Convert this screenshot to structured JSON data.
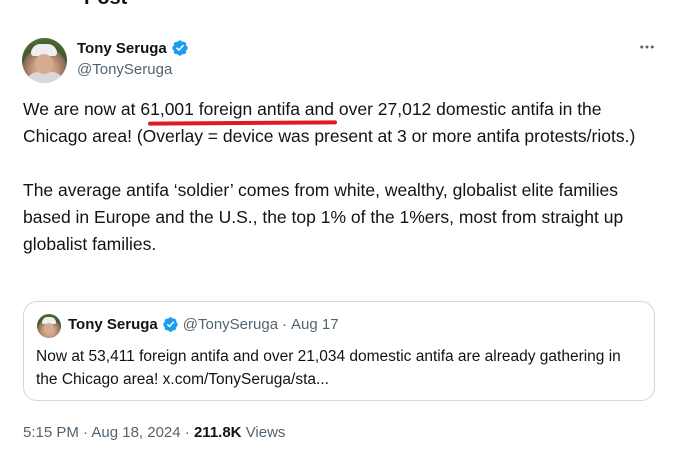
{
  "header": {
    "title_partial": "Post"
  },
  "tweet": {
    "author": {
      "name": "Tony Seruga",
      "handle": "@TonySeruga"
    },
    "paragraphs": [
      "We are now at 61,001 foreign antifa and over 27,012 domestic antifa in the Chicago area! (Overlay = device was present at 3 or more antifa protests/riots.)",
      "The average antifa ‘soldier’ comes from white, wealthy, globalist elite families based in Europe and the U.S., the top 1% of the 1%ers, most from straight up globalist families."
    ],
    "highlight": {
      "text": "61,001 foreign antifa",
      "color": "#e0191e"
    },
    "timestamp": "5:15 PM · Aug 18, 2024",
    "separator": "·",
    "views_count": "211.8K",
    "views_label": "Views"
  },
  "quote": {
    "author": {
      "name": "Tony Seruga",
      "handle": "@TonySeruga"
    },
    "separator": "·",
    "date": "Aug 17",
    "text": "Now at 53,411 foreign antifa and over 21,034 domestic antifa are already gathering in the Chicago area! x.com/TonySeruga/sta..."
  },
  "colors": {
    "text_primary": "#0f1419",
    "text_secondary": "#536471",
    "verified_blue": "#1d9bf0",
    "border": "#cfd9de"
  },
  "icons": {
    "verified": "verified-badge-icon",
    "more": "more-options-icon"
  }
}
